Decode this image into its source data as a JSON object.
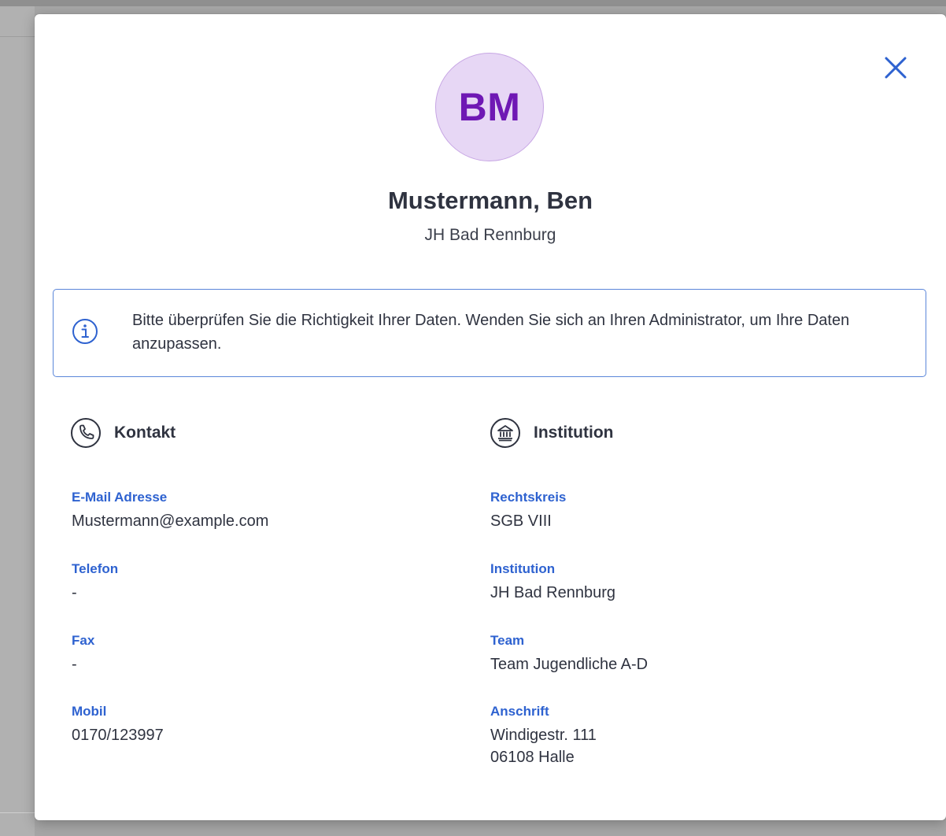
{
  "colors": {
    "accent": "#2e62d0",
    "avatar_bg": "#e7d7f5",
    "avatar_text": "#6f18b4",
    "info_border": "#5b86d9"
  },
  "modal": {
    "close_icon": "close-icon",
    "avatar_initials": "BM",
    "user_name": "Mustermann, Ben",
    "organization": "JH Bad Rennburg",
    "info_icon": "info-icon",
    "info_message": "Bitte überprüfen Sie die Richtigkeit Ihrer Daten. Wenden Sie sich an Ihren Administrator, um Ihre Daten anzupassen.",
    "contact": {
      "icon": "phone-icon",
      "title": "Kontakt",
      "fields": [
        {
          "label": "E-Mail Adresse",
          "value": "Mustermann@example.com"
        },
        {
          "label": "Telefon",
          "value": "-"
        },
        {
          "label": "Fax",
          "value": "-"
        },
        {
          "label": "Mobil",
          "value": "0170/123997"
        }
      ]
    },
    "institution": {
      "icon": "bank-icon",
      "title": "Institution",
      "fields": [
        {
          "label": "Rechtskreis",
          "value": "SGB VIII"
        },
        {
          "label": "Institution",
          "value": "JH Bad Rennburg"
        },
        {
          "label": "Team",
          "value": "Team Jugendliche A-D"
        },
        {
          "label": "Anschrift",
          "value": "Windigestr. 111\n06108 Halle"
        }
      ]
    }
  }
}
